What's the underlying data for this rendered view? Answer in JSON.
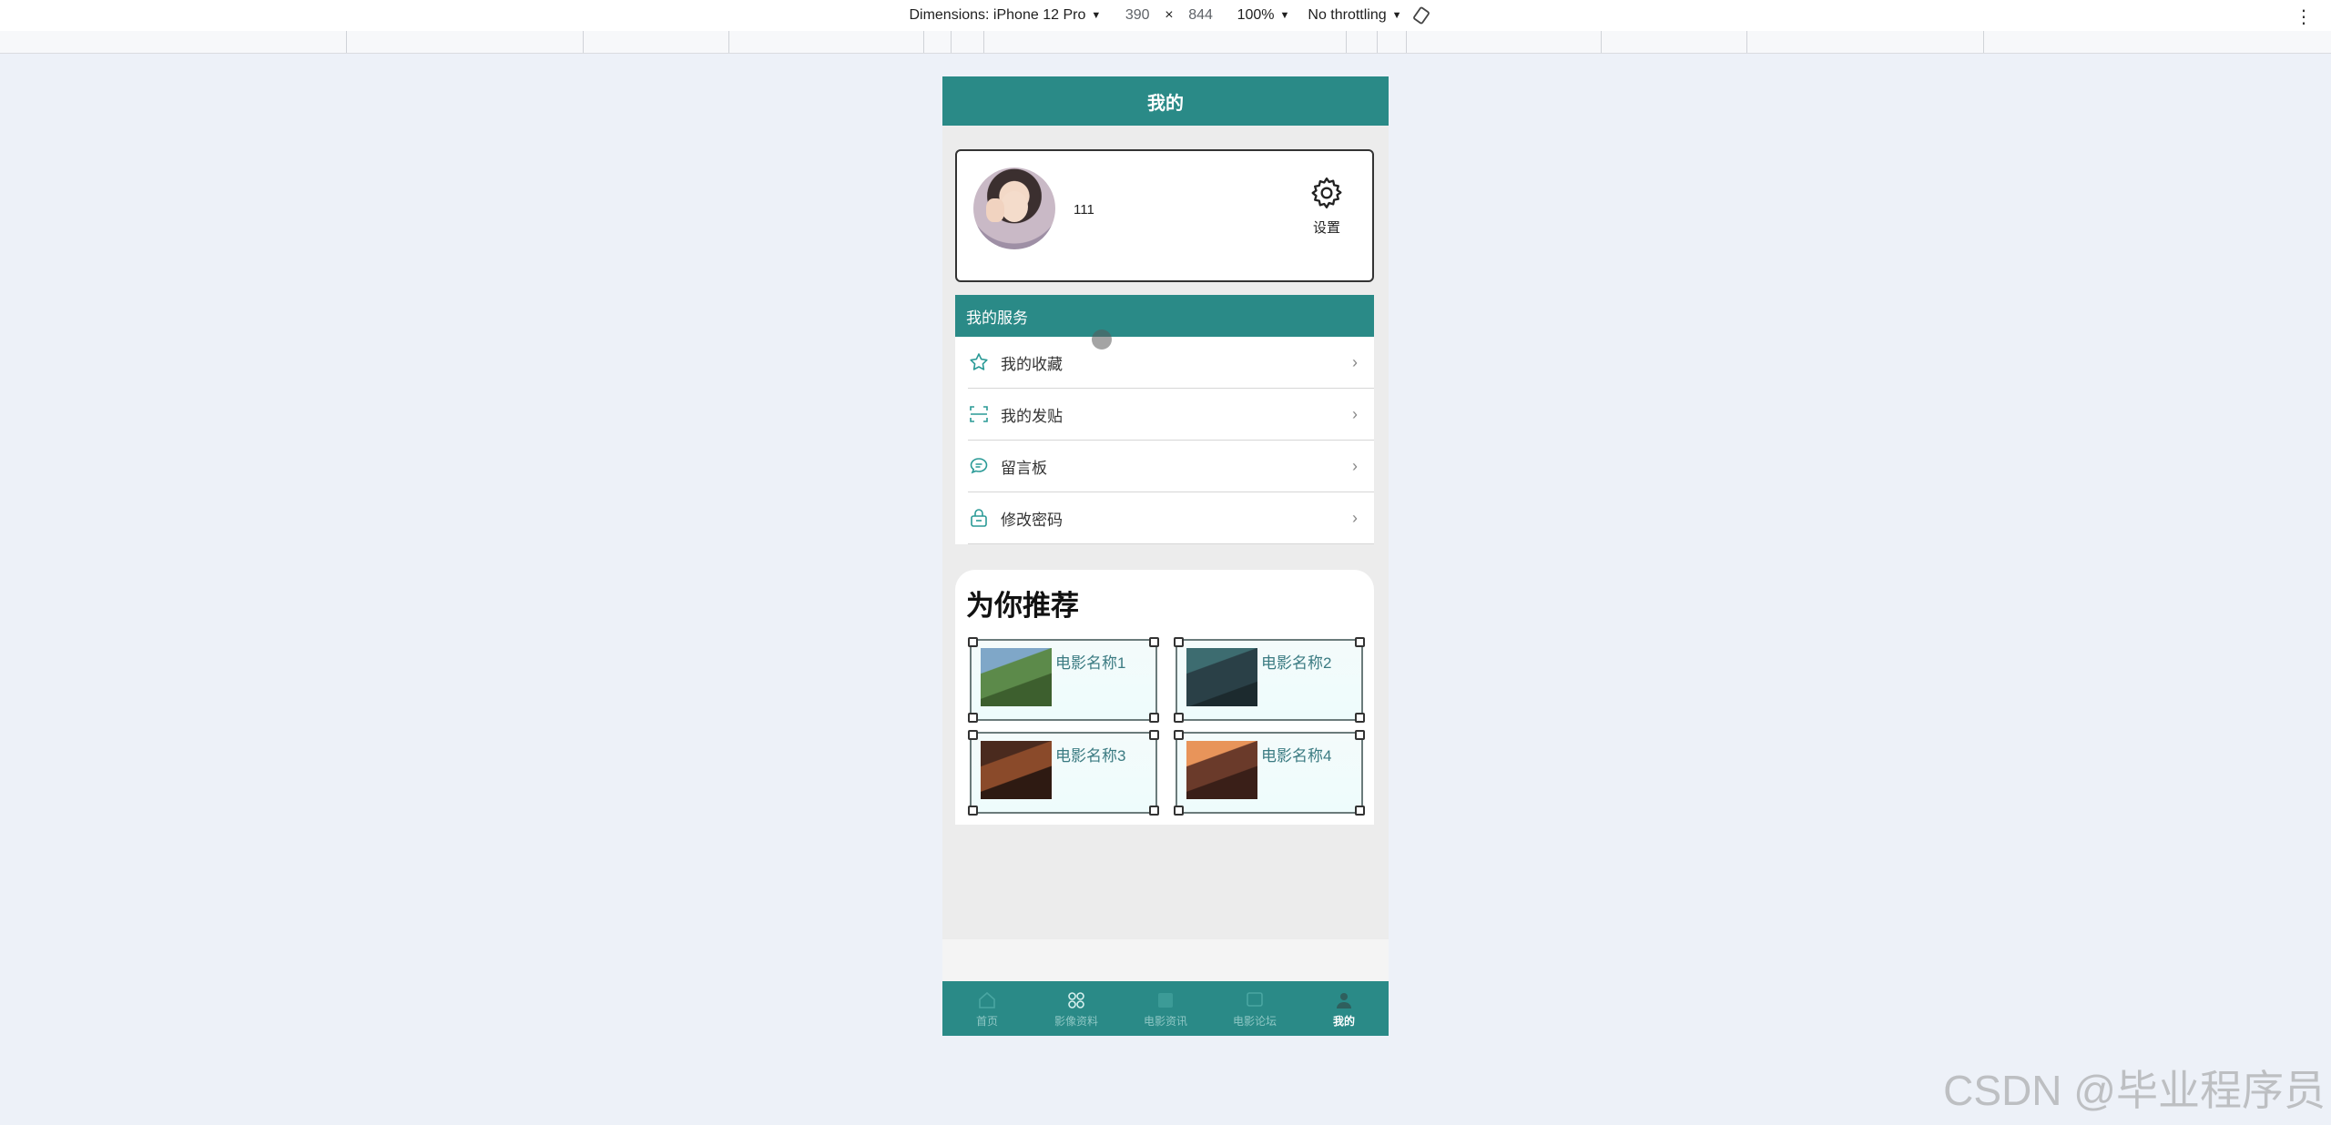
{
  "devtools": {
    "dimensions_label": "Dimensions: iPhone 12 Pro",
    "width": "390",
    "times": "×",
    "height": "844",
    "zoom": "100%",
    "throttling": "No throttling"
  },
  "page": {
    "title": "我的",
    "user": {
      "name": "111"
    },
    "settings_label": "设置",
    "services": {
      "header": "我的服务",
      "items": [
        {
          "label": "我的收藏",
          "icon": "star-icon"
        },
        {
          "label": "我的发贴",
          "icon": "scan-icon"
        },
        {
          "label": "留言板",
          "icon": "chat-icon"
        },
        {
          "label": "修改密码",
          "icon": "lock-icon"
        }
      ]
    },
    "recommend": {
      "title": "为你推荐",
      "movies": [
        {
          "name": "电影名称1"
        },
        {
          "name": "电影名称2"
        },
        {
          "name": "电影名称3"
        },
        {
          "name": "电影名称4"
        }
      ]
    },
    "tabbar": [
      {
        "label": "首页",
        "icon": "home-icon"
      },
      {
        "label": "影像资料",
        "icon": "grid-icon"
      },
      {
        "label": "电影资讯",
        "icon": "news-icon"
      },
      {
        "label": "电影论坛",
        "icon": "forum-icon"
      },
      {
        "label": "我的",
        "icon": "user-icon",
        "active": true
      }
    ]
  },
  "colors": {
    "accent": "#2a8a87",
    "card_title": "#3b7b82"
  },
  "watermark": "CSDN @毕业程序员"
}
